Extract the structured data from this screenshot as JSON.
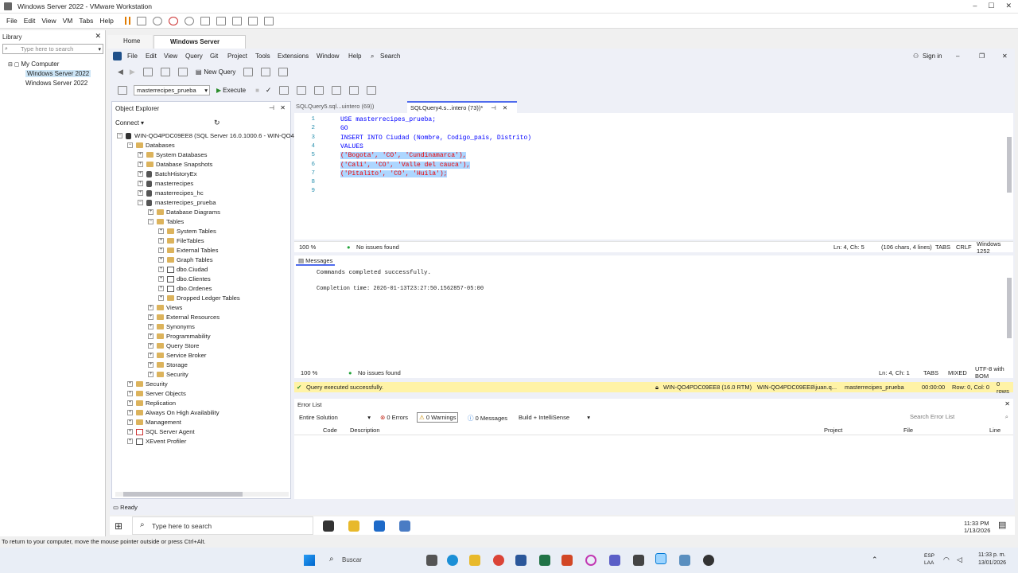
{
  "vmware": {
    "title": "Windows Server 2022 - VMware Workstation",
    "menu": [
      "File",
      "Edit",
      "View",
      "VM",
      "Tabs",
      "Help"
    ],
    "library_label": "Library",
    "library_search_placeholder": "Type here to search",
    "tree": [
      "My Computer",
      "Windows Server 2022",
      "Windows Server 2022"
    ],
    "tabs": [
      "Home",
      "Windows Server 2022"
    ],
    "status_hint": "To return to your computer, move the mouse pointer outside or press Ctrl+Alt."
  },
  "ssms": {
    "menu": [
      "File",
      "Edit",
      "View",
      "Query",
      "Git",
      "Project",
      "Tools",
      "Extensions",
      "Window",
      "Help",
      "Search"
    ],
    "sign_in": "Sign in",
    "new_query": "New Query",
    "database": "masterrecipes_prueba",
    "execute": "Execute",
    "object_explorer": {
      "title": "Object Explorer",
      "connect": "Connect",
      "server": "WIN-QO4PDC09EE8 (SQL Server 16.0.1000.6 - WIN-QO4P",
      "nodes": [
        {
          "label": "Databases",
          "level": 1,
          "kind": "folder",
          "exp": "−"
        },
        {
          "label": "System Databases",
          "level": 2,
          "kind": "folder",
          "exp": "+"
        },
        {
          "label": "Database Snapshots",
          "level": 2,
          "kind": "folder",
          "exp": "+"
        },
        {
          "label": "BatchHistoryEx",
          "level": 2,
          "kind": "db",
          "exp": "+"
        },
        {
          "label": "masterrecipes",
          "level": 2,
          "kind": "db",
          "exp": "+"
        },
        {
          "label": "masterrecipes_hc",
          "level": 2,
          "kind": "db",
          "exp": "+"
        },
        {
          "label": "masterrecipes_prueba",
          "level": 2,
          "kind": "db",
          "exp": "−"
        },
        {
          "label": "Database Diagrams",
          "level": 3,
          "kind": "folder",
          "exp": "+"
        },
        {
          "label": "Tables",
          "level": 3,
          "kind": "folder",
          "exp": "−"
        },
        {
          "label": "System Tables",
          "level": 4,
          "kind": "folder",
          "exp": "+"
        },
        {
          "label": "FileTables",
          "level": 4,
          "kind": "folder",
          "exp": "+"
        },
        {
          "label": "External Tables",
          "level": 4,
          "kind": "folder",
          "exp": "+"
        },
        {
          "label": "Graph Tables",
          "level": 4,
          "kind": "folder",
          "exp": "+"
        },
        {
          "label": "dbo.Ciudad",
          "level": 4,
          "kind": "table",
          "exp": "+"
        },
        {
          "label": "dbo.Clientes",
          "level": 4,
          "kind": "table",
          "exp": "+"
        },
        {
          "label": "dbo.Ordenes",
          "level": 4,
          "kind": "table",
          "exp": "+"
        },
        {
          "label": "Dropped Ledger Tables",
          "level": 4,
          "kind": "folder",
          "exp": "+"
        },
        {
          "label": "Views",
          "level": 3,
          "kind": "folder",
          "exp": "+"
        },
        {
          "label": "External Resources",
          "level": 3,
          "kind": "folder",
          "exp": "+"
        },
        {
          "label": "Synonyms",
          "level": 3,
          "kind": "folder",
          "exp": "+"
        },
        {
          "label": "Programmability",
          "level": 3,
          "kind": "folder",
          "exp": "+"
        },
        {
          "label": "Query Store",
          "level": 3,
          "kind": "folder",
          "exp": "+"
        },
        {
          "label": "Service Broker",
          "level": 3,
          "kind": "folder",
          "exp": "+"
        },
        {
          "label": "Storage",
          "level": 3,
          "kind": "folder",
          "exp": "+"
        },
        {
          "label": "Security",
          "level": 3,
          "kind": "folder",
          "exp": "+"
        },
        {
          "label": "Security",
          "level": 1,
          "kind": "folder",
          "exp": "+"
        },
        {
          "label": "Server Objects",
          "level": 1,
          "kind": "folder",
          "exp": "+"
        },
        {
          "label": "Replication",
          "level": 1,
          "kind": "folder",
          "exp": "+"
        },
        {
          "label": "Always On High Availability",
          "level": 1,
          "kind": "folder",
          "exp": "+"
        },
        {
          "label": "Management",
          "level": 1,
          "kind": "folder",
          "exp": "+"
        },
        {
          "label": "SQL Server Agent",
          "level": 1,
          "kind": "agent",
          "exp": "+"
        },
        {
          "label": "XEvent Profiler",
          "level": 1,
          "kind": "xe",
          "exp": "+"
        }
      ]
    },
    "doc_tabs": [
      "SQLQuery5.sql...uintero (69))",
      "SQLQuery4.s...intero (73))*"
    ],
    "editor": {
      "line_numbers": [
        "1",
        "2",
        "3",
        "4",
        "5",
        "6",
        "7",
        "8",
        "9"
      ],
      "lines": [
        "USE masterrecipes_prueba;",
        "GO",
        "INSERT INTO Ciudad (Nombre, Codigo_pais, Distrito)",
        "VALUES",
        "('Bogota', 'CO', 'Cundinamarca'),",
        "('Cali', 'CO', 'Valle del cauca'),",
        "('Pitalito', 'CO', 'Huila');",
        "",
        ""
      ],
      "zoom": "100 %",
      "issues": "No issues found",
      "position": "Ln: 4, Ch: 5",
      "selection": "(106 chars, 4 lines)",
      "tabs": "TABS",
      "eol": "CRLF",
      "encoding": "Windows 1252"
    },
    "messages": {
      "tab": "Messages",
      "line1": "Commands completed successfully.",
      "line2": "Completion time: 2026-01-13T23:27:50.1562857-05:00",
      "zoom": "100 %",
      "issues": "No issues found",
      "position": "Ln: 4, Ch: 1",
      "tabs": "TABS",
      "eol": "MIXED",
      "encoding": "UTF-8 with BOM"
    },
    "query_status": {
      "text": "Query executed successfully.",
      "server": "WIN-QO4PDC09EE8 (16.0 RTM)",
      "user": "WIN-QO4PDC09EE8\\juan.q...",
      "db": "masterrecipes_prueba",
      "time": "00:00:00",
      "rowcol": "Row: 0, Col: 0",
      "rows": "0 rows"
    },
    "error_list": {
      "title": "Error List",
      "scope": "Entire Solution",
      "errors": "0 Errors",
      "warnings": "0 Warnings",
      "messages": "0 Messages",
      "build": "Build + IntelliSense",
      "search_placeholder": "Search Error List",
      "columns": [
        "Code",
        "Description",
        "Project",
        "File",
        "Line"
      ]
    },
    "status": "Ready"
  },
  "guest_taskbar": {
    "search_placeholder": "Type here to search",
    "time": "11:33 PM",
    "date": "1/13/2026"
  },
  "host_taskbar": {
    "search": "Buscar",
    "lang1": "ESP",
    "lang2": "LAA",
    "time": "11:33 p. m.",
    "date": "13/01/2026"
  }
}
